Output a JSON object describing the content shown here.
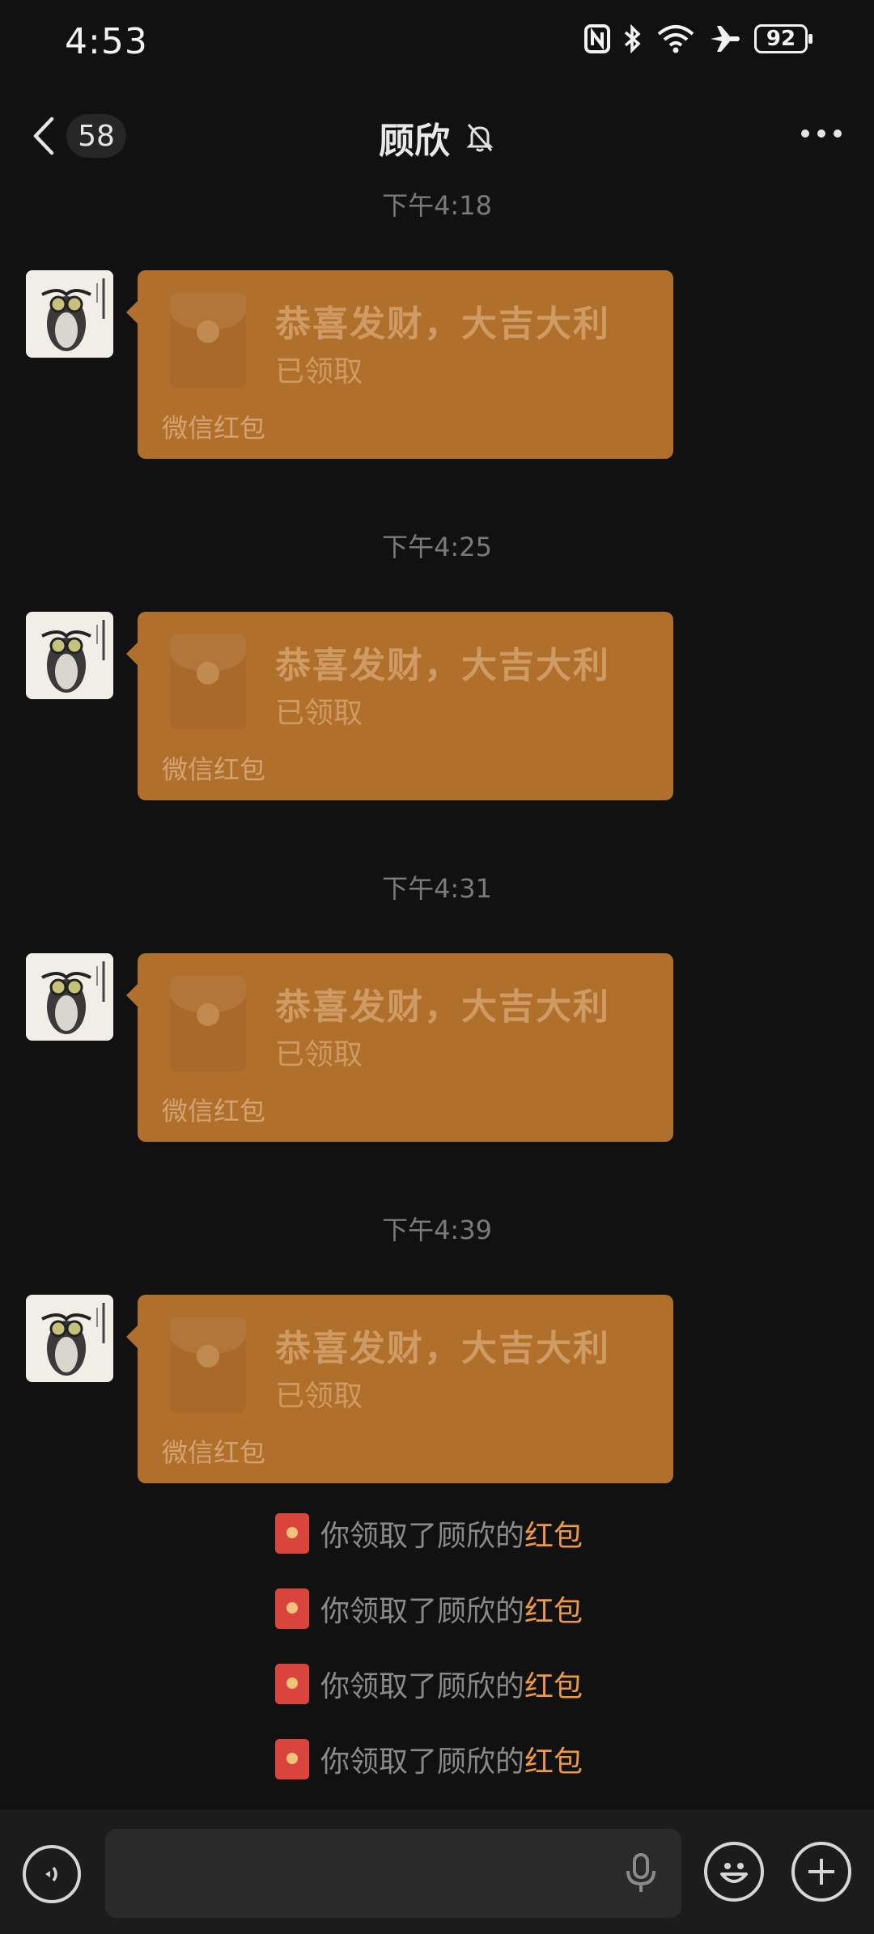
{
  "status_bar": {
    "time": "4:53",
    "battery": "92"
  },
  "header": {
    "back_count": "58",
    "title": "顾欣"
  },
  "messages": [
    {
      "time": "下午4:18",
      "title": "恭喜发财，大吉大利",
      "status": "已领取",
      "footer": "微信红包"
    },
    {
      "time": "下午4:25",
      "title": "恭喜发财，大吉大利",
      "status": "已领取",
      "footer": "微信红包"
    },
    {
      "time": "下午4:31",
      "title": "恭喜发财，大吉大利",
      "status": "已领取",
      "footer": "微信红包"
    },
    {
      "time": "下午4:39",
      "title": "恭喜发财，大吉大利",
      "status": "已领取",
      "footer": "微信红包"
    }
  ],
  "system_notices": [
    {
      "text": "你领取了顾欣的",
      "link": "红包"
    },
    {
      "text": "你领取了顾欣的",
      "link": "红包"
    },
    {
      "text": "你领取了顾欣的",
      "link": "红包"
    },
    {
      "text": "你领取了顾欣的",
      "link": "红包"
    }
  ],
  "input": {
    "placeholder": ""
  },
  "colors": {
    "bubble": "#b0702c",
    "link": "#ef9a40",
    "background": "#111111"
  }
}
